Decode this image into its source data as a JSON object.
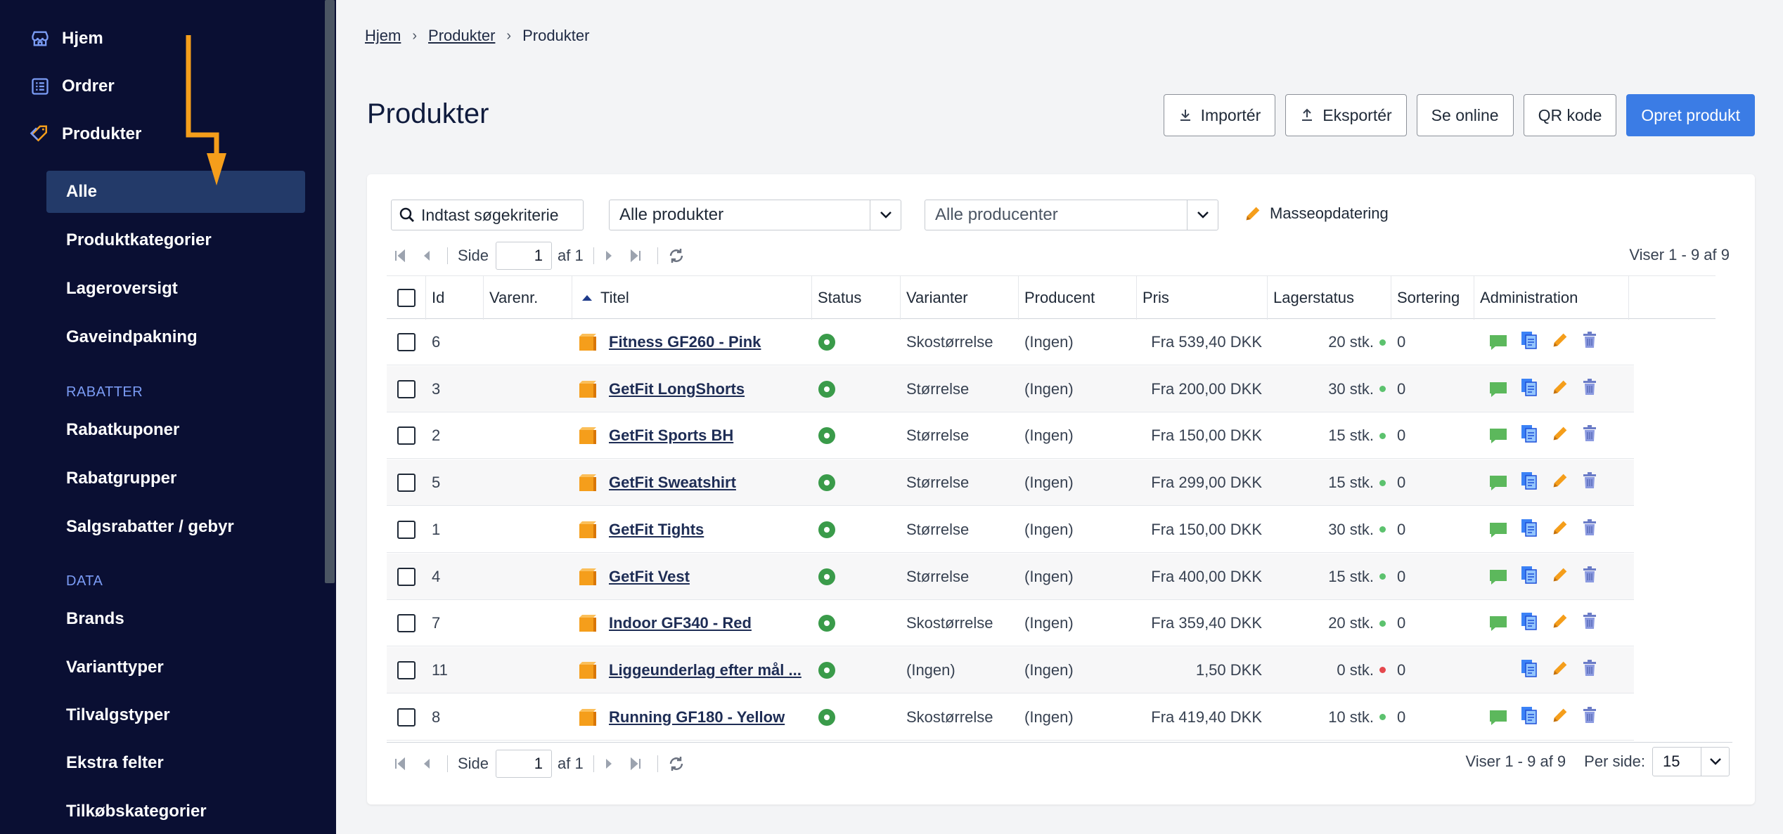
{
  "sidebar": {
    "home": "Hjem",
    "orders": "Ordrer",
    "products": "Produkter",
    "products_sub": [
      "Alle",
      "Produktkategorier",
      "Lageroversigt",
      "Gaveindpakning"
    ],
    "section_rabatter": "RABATTER",
    "rabatter_items": [
      "Rabatkuponer",
      "Rabatgrupper",
      "Salgsrabatter / gebyr"
    ],
    "section_data": "DATA",
    "data_items": [
      "Brands",
      "Varianttyper",
      "Tilvalgstyper",
      "Ekstra felter",
      "Tilkøbskategorier"
    ]
  },
  "breadcrumb": [
    "Hjem",
    "Produkter",
    "Produkter"
  ],
  "page_title": "Produkter",
  "toolbar": {
    "import": "Importér",
    "export": "Eksportér",
    "online": "Se online",
    "qr": "QR kode",
    "create": "Opret produkt"
  },
  "filters": {
    "search_placeholder": "Indtast søgekriterie",
    "products_select": "Alle produkter",
    "producer_select": "Alle producenter",
    "mass_update": "Masseopdatering"
  },
  "pager": {
    "side": "Side",
    "page": "1",
    "of": "af 1",
    "viser": "Viser 1 - 9 af 9",
    "per_side": "Per side:",
    "per_side_value": "15"
  },
  "columns": [
    "Id",
    "Varenr.",
    "Titel",
    "Status",
    "Varianter",
    "Producent",
    "Pris",
    "Lagerstatus",
    "Sortering",
    "Administration"
  ],
  "rows": [
    {
      "id": "6",
      "sku": "",
      "title": "Fitness GF260 - Pink",
      "variants": "Skostørrelse",
      "producer": "(Ingen)",
      "price": "Fra 539,40 DKK",
      "stock": "20 stk.",
      "sort": "0",
      "note": true
    },
    {
      "id": "3",
      "sku": "",
      "title": "GetFit LongShorts",
      "variants": "Størrelse",
      "producer": "(Ingen)",
      "price": "Fra 200,00 DKK",
      "stock": "30 stk.",
      "sort": "0",
      "note": true
    },
    {
      "id": "2",
      "sku": "",
      "title": "GetFit Sports BH",
      "variants": "Størrelse",
      "producer": "(Ingen)",
      "price": "Fra 150,00 DKK",
      "stock": "15 stk.",
      "sort": "0",
      "note": true
    },
    {
      "id": "5",
      "sku": "",
      "title": "GetFit Sweatshirt",
      "variants": "Størrelse",
      "producer": "(Ingen)",
      "price": "Fra 299,00 DKK",
      "stock": "15 stk.",
      "sort": "0",
      "note": true
    },
    {
      "id": "1",
      "sku": "",
      "title": "GetFit Tights",
      "variants": "Størrelse",
      "producer": "(Ingen)",
      "price": "Fra 150,00 DKK",
      "stock": "30 stk.",
      "sort": "0",
      "note": true
    },
    {
      "id": "4",
      "sku": "",
      "title": "GetFit Vest",
      "variants": "Størrelse",
      "producer": "(Ingen)",
      "price": "Fra 400,00 DKK",
      "stock": "15 stk.",
      "sort": "0",
      "note": true
    },
    {
      "id": "7",
      "sku": "",
      "title": "Indoor GF340 - Red",
      "variants": "Skostørrelse",
      "producer": "(Ingen)",
      "price": "Fra 359,40 DKK",
      "stock": "20 stk.",
      "sort": "0",
      "note": true
    },
    {
      "id": "11",
      "sku": "",
      "title": "Liggeunderlag efter mål ...",
      "variants": "(Ingen)",
      "producer": "(Ingen)",
      "price": "1,50 DKK",
      "stock": "0 stk.",
      "sort": "0",
      "note": false
    },
    {
      "id": "8",
      "sku": "",
      "title": "Running GF180 - Yellow",
      "variants": "Skostørrelse",
      "producer": "(Ingen)",
      "price": "Fra 419,40 DKK",
      "stock": "10 stk.",
      "sort": "0",
      "note": true
    }
  ],
  "colors": {
    "sidebar_bg": "#0a0f33",
    "active_bg": "#233a69",
    "primary": "#3b7ce5",
    "status_ok": "#3a9b4a",
    "stock_ok": "#5cc26e",
    "stock_empty": "#e5484d",
    "accent_orange": "#f59e1b"
  }
}
